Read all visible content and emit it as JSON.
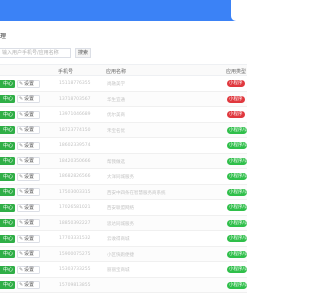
{
  "header": {
    "title": "理"
  },
  "search": {
    "placeholder": "输入用户手机号/应用名称",
    "button_label": "搜索"
  },
  "table": {
    "columns": {
      "phone": "手机号",
      "app": "应用名称",
      "type": "应用类型"
    },
    "center_label": "中心",
    "settings_label": "设置",
    "rows": [
      {
        "phone": "15118776355",
        "app": "尚融美学",
        "type": "小程序",
        "type_color": "red"
      },
      {
        "phone": "13718703567",
        "app": "华生宜通",
        "type": "小程序",
        "type_color": "red"
      },
      {
        "phone": "13971046689",
        "app": "优尔美商",
        "type": "小程序",
        "type_color": "red"
      },
      {
        "phone": "18723774150",
        "app": "禾宝名优",
        "type": "小程序/公众号",
        "type_color": "green"
      },
      {
        "phone": "18602339574",
        "app": "",
        "type": "小程序/公众号",
        "type_color": "green"
      },
      {
        "phone": "18420350666",
        "app": "帮我做选",
        "type": "小程序/公众号",
        "type_color": "green"
      },
      {
        "phone": "18682826566",
        "app": "大洋同城服务",
        "type": "小程序/公众号",
        "type_color": "green"
      },
      {
        "phone": "17503003315",
        "app": "西安中四条在智慧服务商系统",
        "type": "小程序/公众号",
        "type_color": "green"
      },
      {
        "phone": "17026581021",
        "app": "西安联盟网络",
        "type": "小程序/公众号",
        "type_color": "green"
      },
      {
        "phone": "18850392227",
        "app": "思达同城服务",
        "type": "小程序/公众号",
        "type_color": "green"
      },
      {
        "phone": "17703331532",
        "app": "云收得商城",
        "type": "小程序/公众号",
        "type_color": "green"
      },
      {
        "phone": "15900075275",
        "app": "小区快跑便捷",
        "type": "小程序/公众号",
        "type_color": "green"
      },
      {
        "phone": "15303733255",
        "app": "丽丽宝商城",
        "type": "小程序/公众号",
        "type_color": "green"
      },
      {
        "phone": "15709813855",
        "app": "",
        "type": "小程序/公众号",
        "type_color": "green"
      }
    ]
  }
}
